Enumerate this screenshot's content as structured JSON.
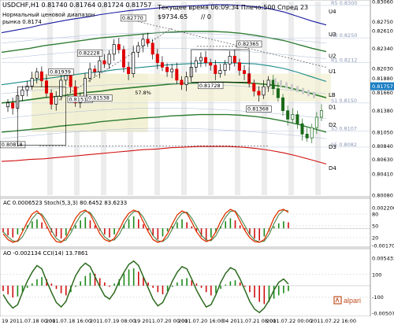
{
  "header": {
    "symbol_line": "USDCHF,H1  0.81740 0.81764 0.81724 0.81757",
    "indicator_name": "Нормальный ценовой диапазон",
    "range_value": "рынка 0.8174",
    "current_time": "Текущее время 06:09:34 Плечо:500 Спред 23",
    "balance": "$9734.65",
    "slash_value": "// 0"
  },
  "subpanel_ac": "AC 0.0006523 Stoch(5,3,3) 80.6452 83.6233",
  "subpanel_ao": "AO -0.002134 CCI(14) 13.7861",
  "watermark": "alpari",
  "colors": {
    "up_candle": "#000000",
    "down_candle": "#e00000",
    "level_band": "#f2f0d0",
    "outer_band": "#1a1aa0",
    "inner_band": "#228b22",
    "green_line": "#2e7d32",
    "teal_line": "#1a8a8a",
    "stoch_line": "#e03000",
    "price_marker_bg": "#1c7fc4"
  },
  "chart_data": {
    "type": "line",
    "instrument": "USDCHF",
    "timeframe": "H1",
    "ohlc_header": {
      "open": 0.8174,
      "high": 0.81764,
      "low": 0.81724,
      "close": 0.81757
    },
    "current_price": 0.81757,
    "ylim": [
      0.8008,
      0.8306
    ],
    "y_ticks": [
      0.8306,
      0.8275,
      0.8261,
      0.8234,
      0.8203,
      0.8188,
      0.81757,
      0.8166,
      0.8138,
      0.8105,
      0.8084,
      0.8063,
      0.8041,
      0.8008
    ],
    "x_ticks": [
      "19 2011.07.18 00:00",
      "2011.07.18 16:00",
      "2011.07.19 08:00",
      "19 2011.07.20 00:00",
      "2011.07.20 16:00",
      "04 2011.07.21 08:00",
      "2011.07.22 00:00",
      "2011.07.22 16:00"
    ],
    "band_labels": [
      "U4",
      "U3",
      "U2",
      "U1",
      "LB",
      "D1",
      "D2",
      "D3",
      "D4"
    ],
    "fib_labels": [
      "R5 0.8300",
      "R3 0.8250",
      "R1 0.8212",
      "S1 0.8150",
      "S3 0.8107",
      "S5 0.8082"
    ],
    "annotations": [
      {
        "text": "0.82770",
        "x": 26,
        "y": 0.8277
      },
      {
        "text": "0.82228",
        "x": 17,
        "y": 0.8223
      },
      {
        "text": "0.81939",
        "x": 11,
        "y": 0.8194
      },
      {
        "text": "0.81517",
        "x": 15,
        "y": 0.8152
      },
      {
        "text": "0.81538",
        "x": 19,
        "y": 0.8154
      },
      {
        "text": "0.81728",
        "x": 42,
        "y": 0.8173
      },
      {
        "text": "0.82365",
        "x": 50,
        "y": 0.8237
      },
      {
        "text": "0.81368",
        "x": 52,
        "y": 0.8137
      },
      {
        "text": "0.80818",
        "x": 1,
        "y": 0.8082
      },
      {
        "text": "57.8%",
        "x": 28,
        "y": 0.8162
      }
    ],
    "close": [
      0.815,
      0.8142,
      0.8161,
      0.817,
      0.8176,
      0.8188,
      0.8198,
      0.8184,
      0.8165,
      0.8148,
      0.816,
      0.8185,
      0.8192,
      0.8175,
      0.815,
      0.816,
      0.8188,
      0.8202,
      0.8198,
      0.8215,
      0.821,
      0.8225,
      0.824,
      0.8232,
      0.8205,
      0.8195,
      0.8228,
      0.8238,
      0.8248,
      0.8242,
      0.8225,
      0.8212,
      0.8205,
      0.8198,
      0.8202,
      0.8185,
      0.8178,
      0.819,
      0.8205,
      0.8215,
      0.822,
      0.8212,
      0.8208,
      0.8195,
      0.82,
      0.821,
      0.8222,
      0.8212,
      0.82,
      0.8195,
      0.818,
      0.8168,
      0.8162,
      0.8175,
      0.8185,
      0.8172,
      0.8158,
      0.8138,
      0.8125,
      0.8132,
      0.8118,
      0.8102,
      0.8096,
      0.8112,
      0.8128,
      0.8138
    ],
    "series": [
      {
        "name": "U4",
        "values": [
          0.8258,
          0.8262,
          0.8266,
          0.8271,
          0.8275,
          0.8279,
          0.8282,
          0.8286,
          0.8289,
          0.8292,
          0.8294,
          0.8296,
          0.8298,
          0.8299,
          0.83,
          0.8301,
          0.8301,
          0.83,
          0.8298,
          0.8295,
          0.829,
          0.8283,
          0.8276,
          0.827
        ]
      },
      {
        "name": "U3",
        "values": [
          0.8228,
          0.8231,
          0.8234,
          0.8238,
          0.8241,
          0.8244,
          0.8247,
          0.825,
          0.8252,
          0.8254,
          0.8256,
          0.8258,
          0.8259,
          0.826,
          0.826,
          0.826,
          0.8259,
          0.8257,
          0.8254,
          0.825,
          0.8246,
          0.824,
          0.8234,
          0.8229
        ]
      },
      {
        "name": "U1",
        "values": [
          0.8178,
          0.8181,
          0.8184,
          0.8187,
          0.819,
          0.8193,
          0.8196,
          0.8198,
          0.8201,
          0.8203,
          0.8205,
          0.8207,
          0.8209,
          0.821,
          0.8211,
          0.8212,
          0.8212,
          0.8211,
          0.821,
          0.8207,
          0.8203,
          0.8197,
          0.819,
          0.8183
        ]
      },
      {
        "name": "LB",
        "values": [
          0.815,
          0.8152,
          0.8155,
          0.8158,
          0.816,
          0.8163,
          0.8166,
          0.8168,
          0.8171,
          0.8173,
          0.8175,
          0.8177,
          0.8179,
          0.818,
          0.8181,
          0.8182,
          0.8182,
          0.8181,
          0.818,
          0.8178,
          0.8175,
          0.817,
          0.8164,
          0.8158
        ]
      },
      {
        "name": "D2",
        "values": [
          0.8105,
          0.8107,
          0.8109,
          0.8111,
          0.8114,
          0.8116,
          0.8118,
          0.8121,
          0.8123,
          0.8125,
          0.8127,
          0.8128,
          0.813,
          0.8131,
          0.8132,
          0.8132,
          0.8132,
          0.8131,
          0.8129,
          0.8126,
          0.8122,
          0.8117,
          0.8111,
          0.8105
        ]
      },
      {
        "name": "D4",
        "values": [
          0.806,
          0.8061,
          0.8063,
          0.8064,
          0.8066,
          0.8068,
          0.807,
          0.8072,
          0.8074,
          0.8076,
          0.8078,
          0.8079,
          0.8081,
          0.8082,
          0.8083,
          0.8083,
          0.8083,
          0.8082,
          0.808,
          0.8077,
          0.8073,
          0.8068,
          0.8062,
          0.8056
        ]
      }
    ],
    "ac_panel": {
      "labels_right": [
        "0.002200",
        "80",
        "50",
        "20",
        "-0.001703"
      ],
      "histogram": [
        -0.0004,
        -0.0007,
        -0.0009,
        -0.0006,
        -0.0002,
        0.0003,
        0.0007,
        0.0009,
        0.0006,
        0.0001,
        -0.0004,
        -0.0008,
        -0.001,
        -0.0007,
        -0.0002,
        0.0003,
        0.0008,
        0.0011,
        0.0008,
        0.0003,
        -0.0002,
        -0.0006,
        -0.0009,
        -0.0006,
        -0.0001,
        0.0004,
        0.0009,
        0.0012,
        0.0009,
        0.0004,
        -0.0002,
        -0.0007,
        -0.0011,
        -0.0008,
        -0.0003,
        0.0002,
        0.0006,
        0.0009,
        0.0006,
        0.0002,
        -0.0003,
        -0.0008,
        -0.0012,
        -0.0009,
        -0.0004,
        0.0002,
        0.0007,
        0.001,
        0.0008,
        0.0003,
        -0.0002,
        -0.0006,
        -0.001,
        -0.0012,
        -0.0008,
        -0.0003,
        0.0002,
        0.0005,
        0.0007,
        0.0006
      ],
      "stoch_main": [
        30,
        15,
        8,
        12,
        35,
        60,
        80,
        88,
        75,
        50,
        25,
        10,
        8,
        20,
        45,
        70,
        85,
        90,
        80,
        55,
        30,
        15,
        10,
        18,
        40,
        65,
        82,
        90,
        85,
        60,
        35,
        15,
        8,
        12,
        30,
        55,
        78,
        88,
        82,
        60,
        35,
        18,
        10,
        15,
        35,
        62,
        82,
        92,
        86,
        62,
        38,
        20,
        10,
        8,
        15,
        40,
        70,
        88,
        92,
        84
      ],
      "stoch_signal": [
        35,
        22,
        12,
        10,
        22,
        45,
        68,
        82,
        80,
        62,
        38,
        18,
        10,
        14,
        32,
        56,
        76,
        87,
        84,
        66,
        42,
        22,
        13,
        14,
        28,
        52,
        73,
        86,
        87,
        72,
        48,
        25,
        12,
        10,
        20,
        42,
        66,
        82,
        85,
        70,
        48,
        26,
        14,
        12,
        25,
        48,
        72,
        87,
        88,
        72,
        50,
        28,
        14,
        9,
        11,
        28,
        55,
        78,
        90,
        88
      ]
    },
    "ao_panel": {
      "labels_right": [
        "0.005433",
        "100",
        "-100",
        "-0.005075"
      ],
      "histogram": [
        -0.001,
        -0.0016,
        -0.0022,
        -0.002,
        -0.0012,
        -0.0004,
        0.0004,
        0.0012,
        0.0016,
        0.0012,
        0.0004,
        -0.0006,
        -0.0014,
        -0.0018,
        -0.0012,
        -0.0002,
        0.0008,
        0.0018,
        0.0024,
        0.0022,
        0.0014,
        0.0006,
        -0.0002,
        0.0004,
        0.0012,
        0.0022,
        0.003,
        0.0032,
        0.0026,
        0.0016,
        0.0006,
        -0.0004,
        -0.0012,
        -0.0016,
        -0.001,
        -0.0002,
        0.0006,
        0.0012,
        0.0014,
        0.001,
        0.0004,
        -0.0004,
        -0.0012,
        -0.0018,
        -0.0014,
        -0.0006,
        0.0002,
        0.0008,
        0.001,
        0.0006,
        -0.0002,
        -0.0012,
        -0.0022,
        -0.003,
        -0.0034,
        -0.003,
        -0.0024,
        -0.0018,
        -0.0014,
        -0.001
      ],
      "cci": [
        -80,
        -150,
        -200,
        -170,
        -60,
        40,
        120,
        180,
        150,
        40,
        -60,
        -150,
        -190,
        -140,
        -20,
        90,
        160,
        200,
        170,
        80,
        -10,
        -90,
        -120,
        -60,
        40,
        120,
        190,
        220,
        180,
        80,
        -20,
        -120,
        -180,
        -150,
        -60,
        40,
        120,
        170,
        150,
        60,
        -40,
        -120,
        -190,
        -170,
        -80,
        30,
        110,
        160,
        140,
        60,
        -40,
        -140,
        -210,
        -240,
        -200,
        -130,
        -40,
        30,
        60,
        14
      ]
    }
  }
}
